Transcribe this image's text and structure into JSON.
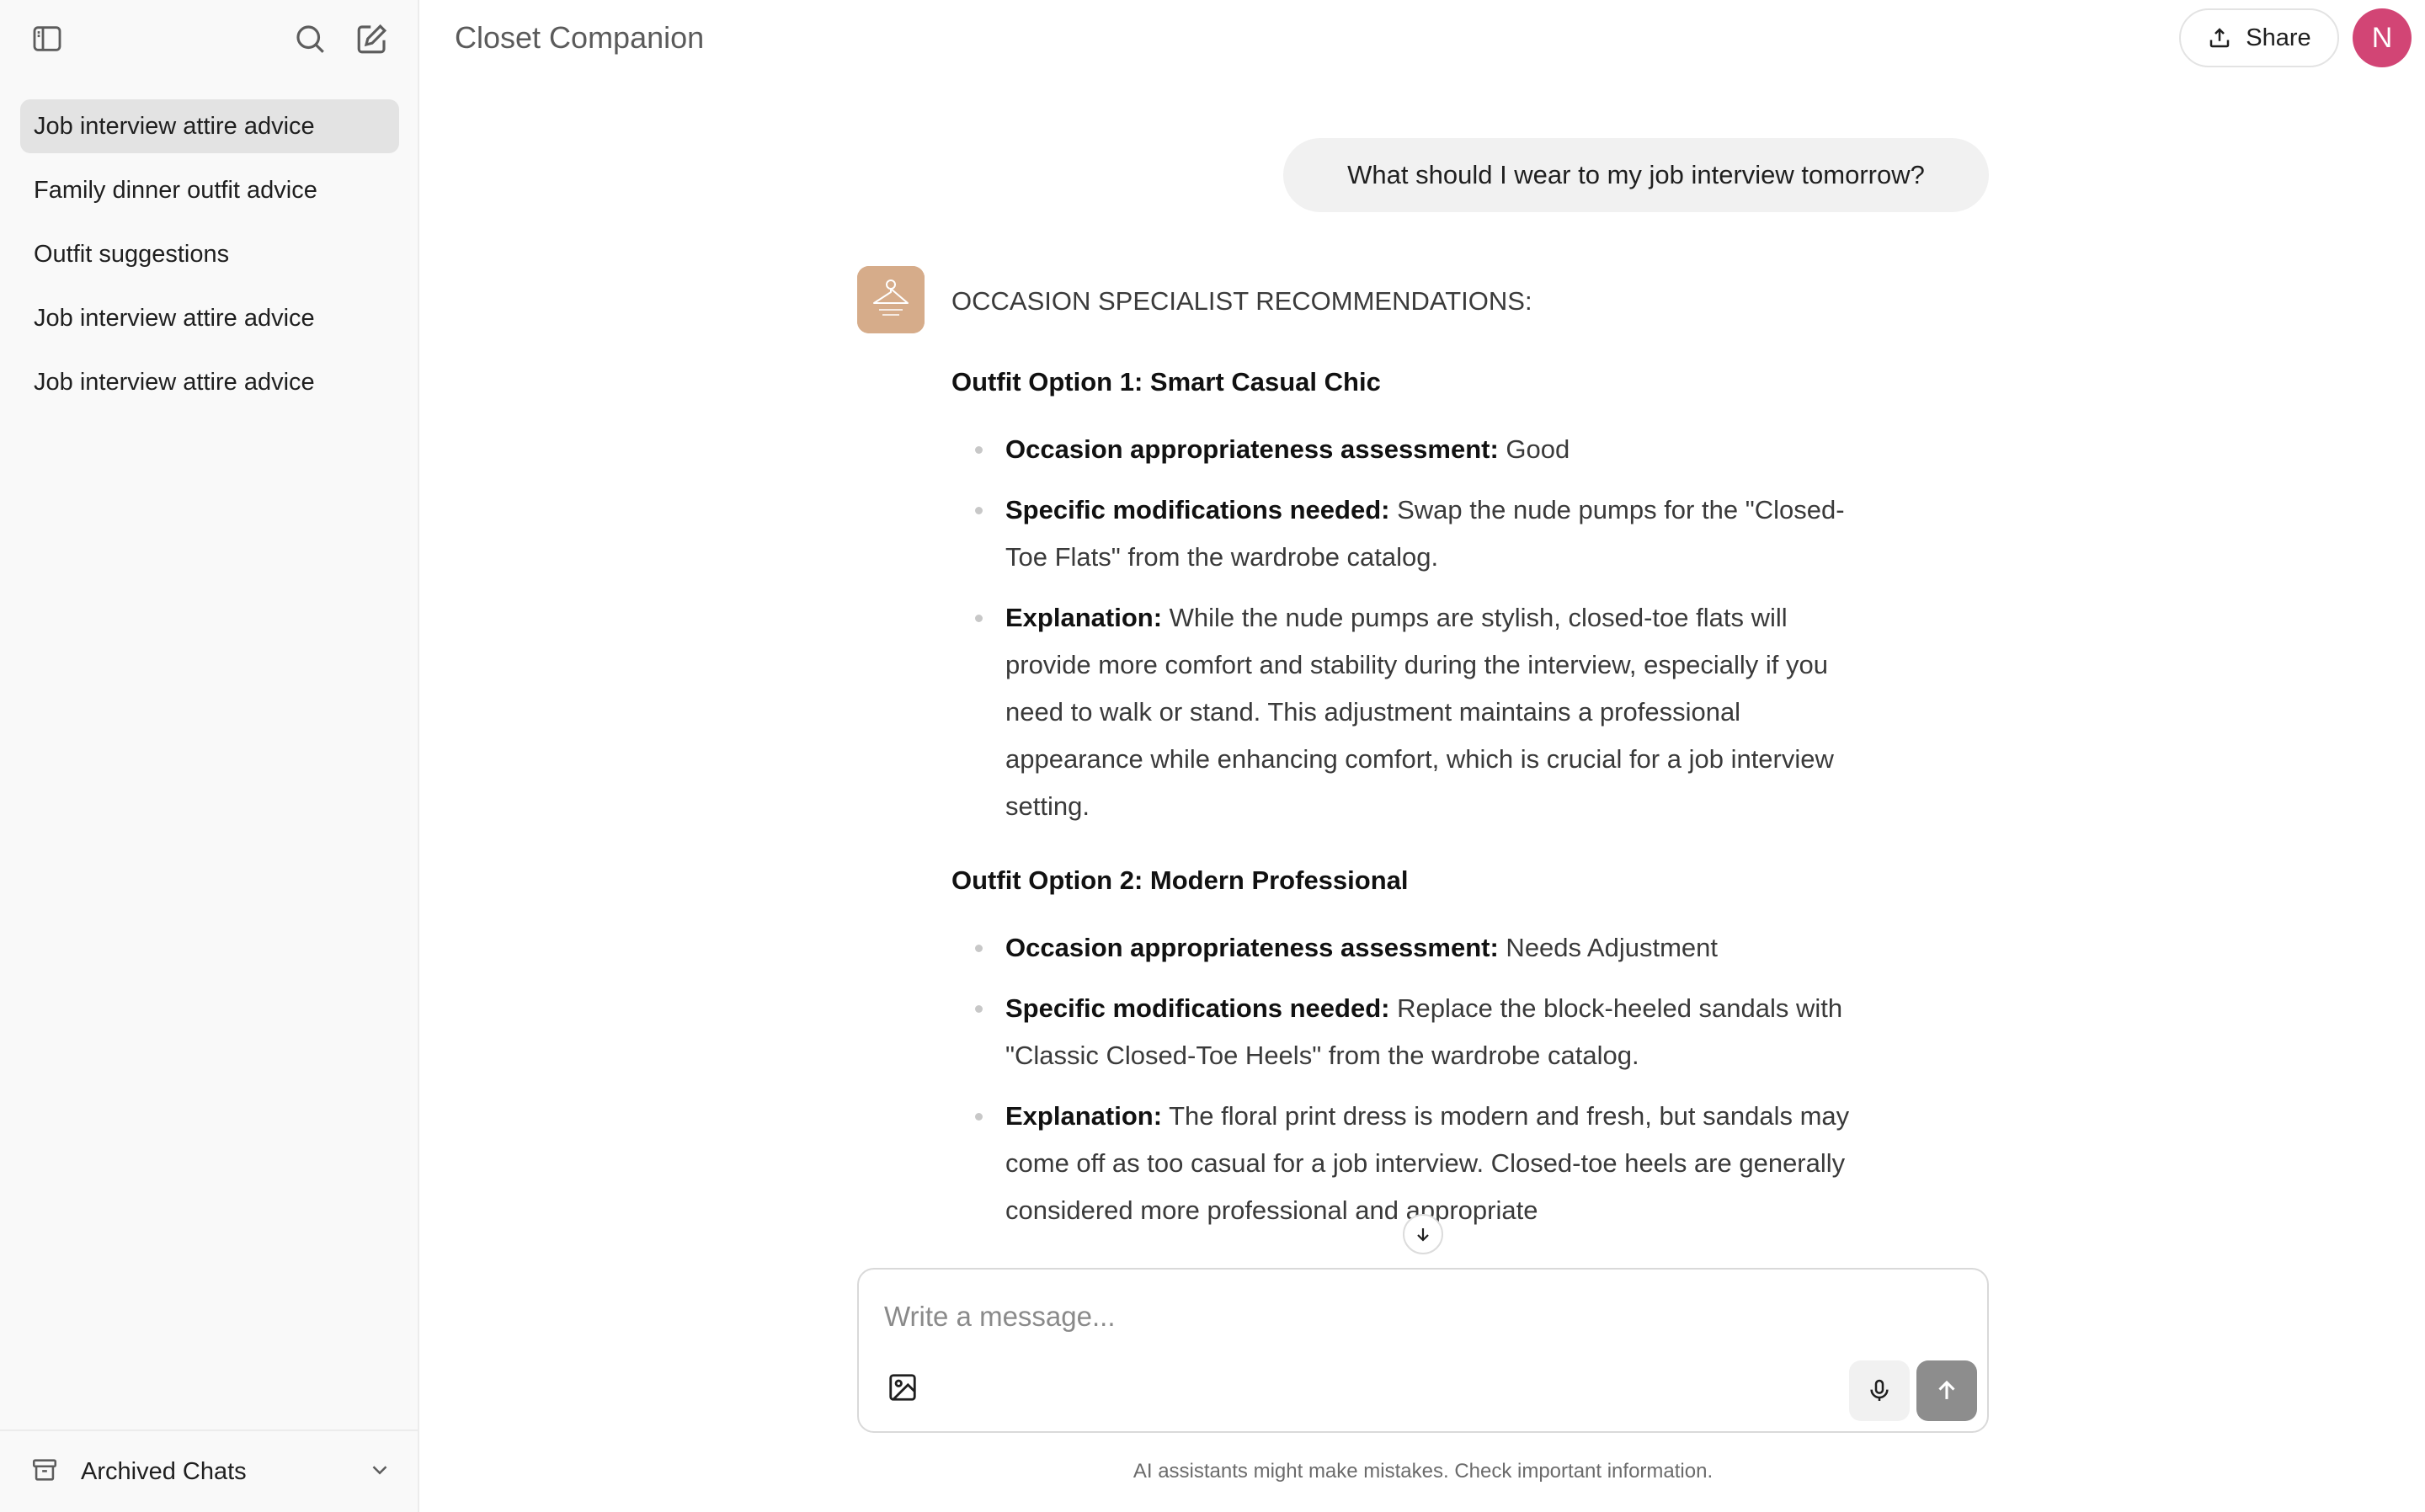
{
  "header": {
    "title": "Closet Companion",
    "share_label": "Share",
    "avatar_initial": "N"
  },
  "sidebar": {
    "items": [
      {
        "label": "Job interview attire advice"
      },
      {
        "label": "Family dinner outfit advice"
      },
      {
        "label": "Outfit suggestions"
      },
      {
        "label": "Job interview attire advice"
      },
      {
        "label": "Job interview attire advice"
      }
    ],
    "footer_label": "Archived Chats"
  },
  "chat": {
    "user_message": "What should I wear to my job interview tomorrow?",
    "assistant": {
      "intro": "OCCASION SPECIALIST RECOMMENDATIONS:",
      "options": [
        {
          "title": "Outfit Option 1: Smart Casual Chic",
          "bullets": [
            {
              "label": "Occasion appropriateness assessment:",
              "text": " Good"
            },
            {
              "label": "Specific modifications needed:",
              "text": " Swap the nude pumps for the \"Closed-Toe Flats\" from the wardrobe catalog."
            },
            {
              "label": "Explanation:",
              "text": " While the nude pumps are stylish, closed-toe flats will provide more comfort and stability during the interview, especially if you need to walk or stand. This adjustment maintains a professional appearance while enhancing comfort, which is crucial for a job interview setting."
            }
          ]
        },
        {
          "title": "Outfit Option 2: Modern Professional",
          "bullets": [
            {
              "label": "Occasion appropriateness assessment:",
              "text": " Needs Adjustment"
            },
            {
              "label": "Specific modifications needed:",
              "text": " Replace the block-heeled sandals with \"Classic Closed-Toe Heels\" from the wardrobe catalog."
            },
            {
              "label": "Explanation:",
              "text": " The floral print dress is modern and fresh, but sandals may come off as too casual for a job interview. Closed-toe heels are generally considered more professional and appropriate"
            }
          ]
        }
      ]
    }
  },
  "composer": {
    "placeholder": "Write a message..."
  },
  "disclaimer": "AI assistants might make mistakes. Check important information.",
  "colors": {
    "avatar_bg": "#d24575",
    "sidebar_bg": "#f9f9f9",
    "active_item_bg": "#e3e3e3",
    "user_bubble_bg": "#f1f1f1",
    "send_button_bg": "#8d8d8d"
  }
}
